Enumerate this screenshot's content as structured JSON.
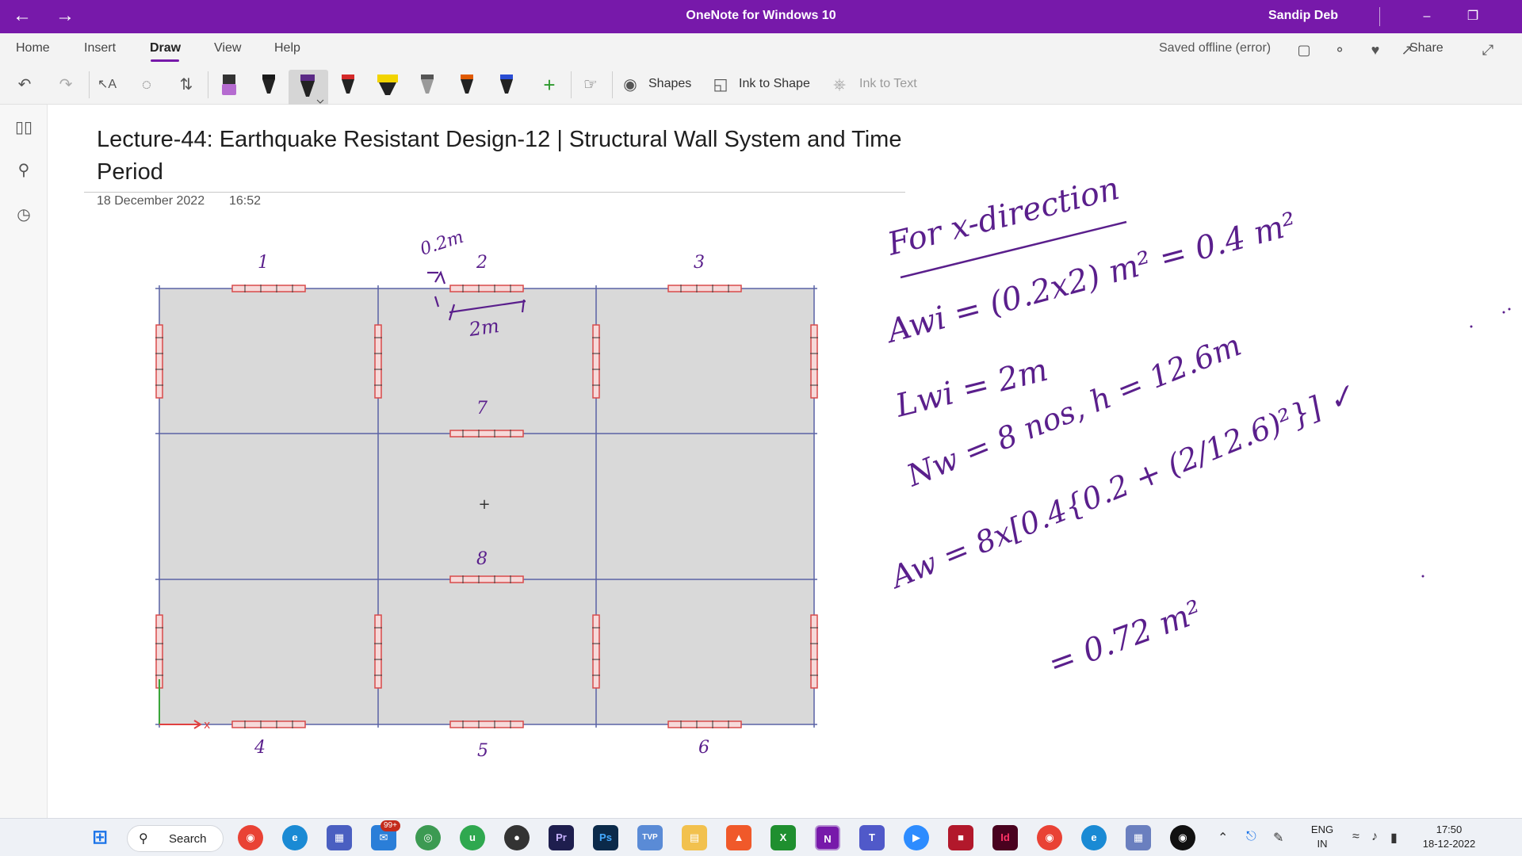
{
  "titlebar": {
    "back_icon": "arrow-left-icon",
    "forward_icon": "arrow-right-icon",
    "app_title": "OneNote for Windows 10",
    "user_name": "Sandip Deb"
  },
  "ribbon": {
    "tabs": [
      "Home",
      "Insert",
      "Draw",
      "View",
      "Help"
    ],
    "active_tab": "Draw",
    "saved_status": "Saved offline (error)",
    "share_label": "Share",
    "accent": "#7719aa"
  },
  "toolbar": {
    "shapes_label": "Shapes",
    "ink_to_shape_label": "Ink to Shape",
    "ink_to_text_label": "Ink to Text",
    "pen_colors": [
      "#b56bd0",
      "#1a1a1a",
      "#5b2a86",
      "#d42a2a",
      "#f2d400",
      "#1a1a1a",
      "#e05a00",
      "#2a4dd4"
    ]
  },
  "page": {
    "title": "Lecture-44: Earthquake Resistant Design-12 | Structural Wall System and Time Period",
    "date": "18 December 2022",
    "time": "16:52"
  },
  "drawing": {
    "axis_x_label": "x",
    "ink_color": "#5a1f8c",
    "ink_lines": [
      "For x-direction",
      "Awi = (0.2x2) m² = 0.4 m²",
      "Lwi = 2m",
      "Nw = 8 nos,  h = 12.6m",
      "Aw = 8x[0.4{0.2 + (2/12.6)²}] ✓",
      "= 0.72 m²"
    ],
    "wall_labels": [
      "1",
      "2",
      "3",
      "4",
      "5",
      "6",
      "7",
      "8"
    ],
    "dim_labels": [
      "0.2m",
      "2m"
    ]
  },
  "taskbar": {
    "search_label": "Search",
    "mail_badge": "99+",
    "lang_top": "ENG",
    "lang_bottom": "IN",
    "clock_time": "17:50",
    "clock_date": "18-12-2022"
  }
}
